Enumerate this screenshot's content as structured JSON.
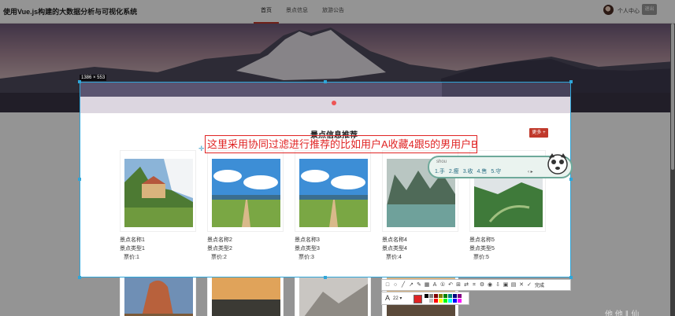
{
  "header": {
    "app_title": "使用Vue.js构建的大数据分析与可视化系统",
    "nav": [
      "首页",
      "景点信息",
      "旅游公告"
    ],
    "user_label": "个人中心",
    "logout_label": "退出"
  },
  "capture": {
    "size_label": "1386 × 553",
    "annotation_text": "这里采用协同过滤进行推荐的比如用户A收藏4跟5的男用户B",
    "toolbar_done": "完成",
    "font_size": "22",
    "current_color": "#e02424",
    "palette": [
      "#000000",
      "#808080",
      "#800000",
      "#808000",
      "#008000",
      "#008080",
      "#000080",
      "#800080",
      "#ffffff",
      "#c0c0c0",
      "#ff0000",
      "#ffff00",
      "#00ff00",
      "#00ffff",
      "#0000ff",
      "#ff00ff"
    ]
  },
  "section": {
    "title": "景点信息推荐",
    "more_label": "更多 +"
  },
  "attractions": [
    {
      "name": "景点名称1",
      "type": "景点类型1",
      "price": "票价:1"
    },
    {
      "name": "景点名称2",
      "type": "景点类型2",
      "price": "票价:2"
    },
    {
      "name": "景点名称3",
      "type": "景点类型3",
      "price": "票价:3"
    },
    {
      "name": "景点名称4",
      "type": "景点类型4",
      "price": "票价:4"
    },
    {
      "name": "景点名称5",
      "type": "景点类型5",
      "price": "票价:5"
    }
  ],
  "ime": {
    "input": "shou",
    "candidates": [
      "1.手",
      "2.瘦",
      "3.收",
      "4.售",
      "5.守"
    ],
    "pager": "‹ ▸"
  },
  "watermark": "他 他 ∥ 仙"
}
